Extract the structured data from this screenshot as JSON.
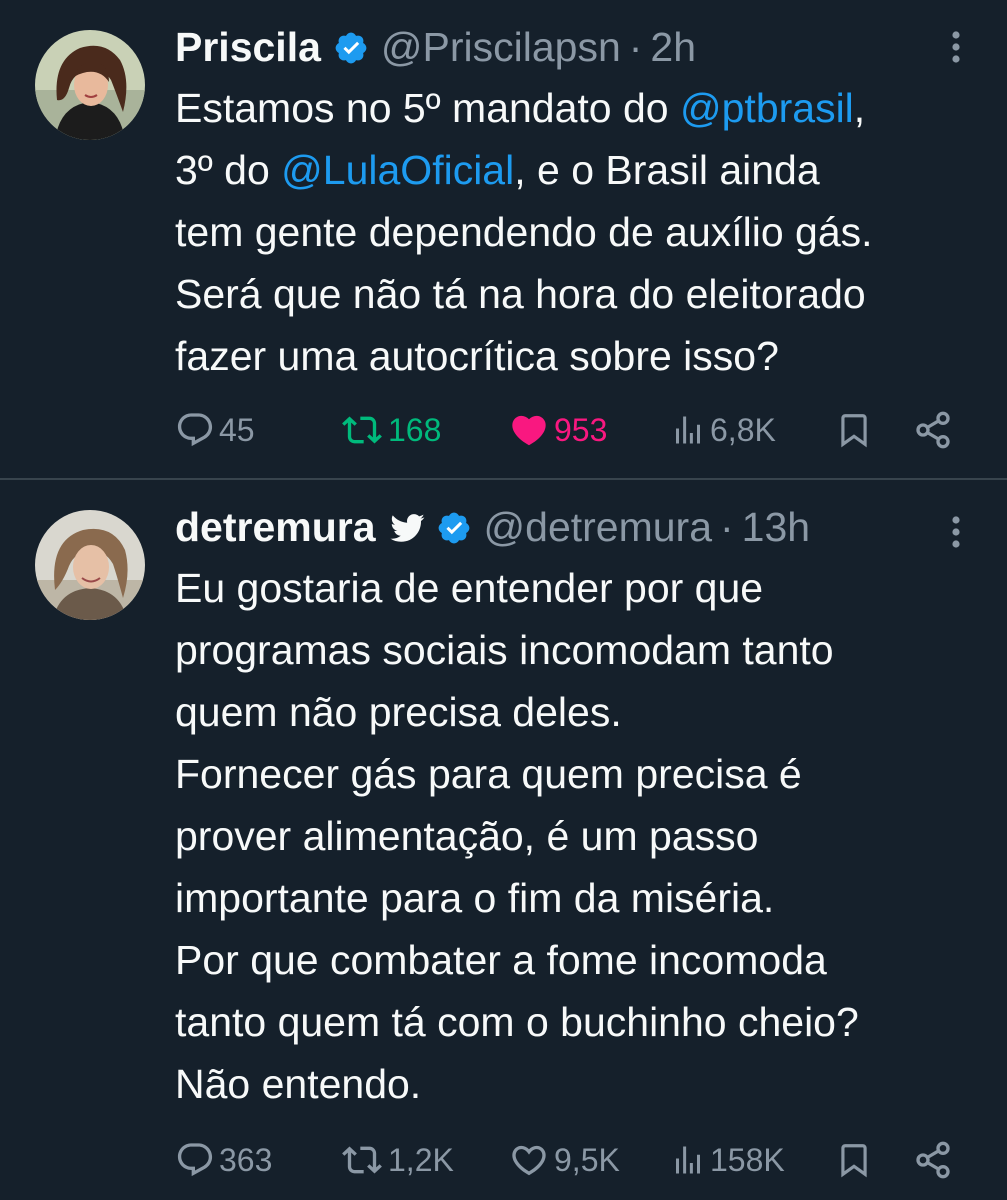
{
  "tweets": [
    {
      "name": "Priscila",
      "handle": "@Priscilapsn",
      "separator": "·",
      "time": "2h",
      "text_parts": [
        {
          "t": "Estamos no 5º mandato do ",
          "mention": false
        },
        {
          "t": "@ptbrasil",
          "mention": true
        },
        {
          "t": ",\n3º do ",
          "mention": false
        },
        {
          "t": "@LulaOficial",
          "mention": true
        },
        {
          "t": ", e o Brasil ainda\ntem gente dependendo de auxílio gás.\nSerá que não tá na hora do eleitorado\nfazer uma autocrítica sobre isso?",
          "mention": false
        }
      ],
      "stats": {
        "replies": "45",
        "retweets": "168",
        "likes": "953",
        "views": "6,8K"
      },
      "retweeted": true,
      "liked": true
    },
    {
      "name": "detremura",
      "handle": "@detremura",
      "separator": "·",
      "time": "13h",
      "text_parts": [
        {
          "t": "Eu gostaria de entender por que\nprogramas sociais incomodam tanto\nquem não precisa deles.\nFornecer gás para quem precisa é\nprover alimentação, é um passo\nimportante para o fim da miséria.\nPor que combater a fome incomoda\ntanto quem tá com o buchinho cheio?\nNão entendo.",
          "mention": false
        }
      ],
      "stats": {
        "replies": "363",
        "retweets": "1,2K",
        "likes": "9,5K",
        "views": "158K"
      },
      "retweeted": false,
      "liked": false
    }
  ],
  "colors": {
    "background": "#15202b",
    "text": "#f7f9f9",
    "secondary": "#8b98a5",
    "accent": "#1d9bf0",
    "retweet_active": "#00ba7c",
    "like_active": "#f91880",
    "divider": "#38444d"
  },
  "icons": {
    "verified": "verified-badge-icon",
    "bird": "twitter-bird-icon",
    "more": "more-options-icon",
    "reply": "reply-icon",
    "retweet": "retweet-icon",
    "like": "heart-icon",
    "views": "views-icon",
    "bookmark": "bookmark-icon",
    "share": "share-icon"
  }
}
